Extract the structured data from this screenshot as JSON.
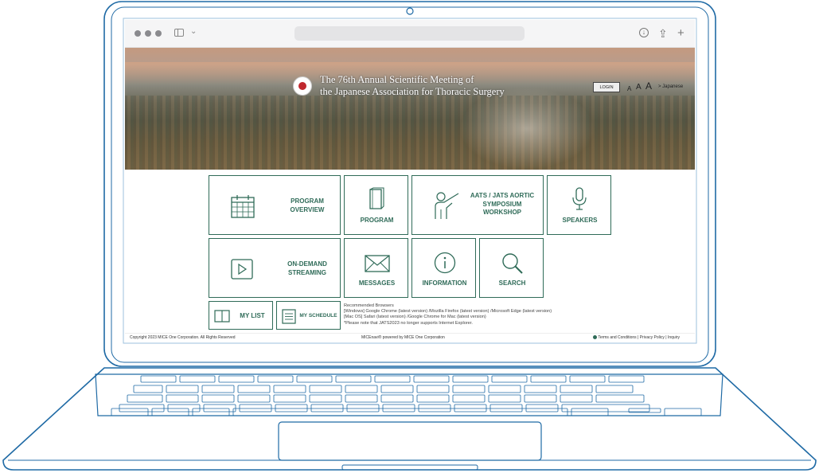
{
  "hero": {
    "title_line1": "The 76th Annual Scientific Meeting of",
    "title_line2": "the Japanese Association for Thoracic Surgery"
  },
  "header": {
    "login_label": "LOGIN",
    "font_small": "A",
    "font_medium": "A",
    "font_large": "A",
    "language_link": "> Japanese"
  },
  "menu": {
    "program_overview": "PROGRAM OVERVIEW",
    "program": "PROGRAM",
    "aats_workshop": "AATS / JATS AORTIC SYMPOSIUM WORKSHOP",
    "speakers": "SPEAKERS",
    "on_demand": "ON-DEMAND STREAMING",
    "messages": "MESSAGES",
    "information": "INFORMATION",
    "search": "SEARCH",
    "my_list": "MY LIST",
    "my_schedule": "MY SCHEDULE"
  },
  "browser_note": {
    "heading": "Recommended Browsers",
    "windows": "[Windows] Google Chrome (latest version) /Mozilla Firefox (latest version) /Microsoft Edge (latest version)",
    "mac": "[Mac OS] Safari (latest version) /Google Chrome for Mac (latest version)",
    "ie_note": "*Please note that JATS2023 no longer supports Internet Explorer."
  },
  "footer": {
    "copyright": "Copyright 2023 MICE One Corporation. All Rights Reserved",
    "powered": "MICEnavi® powered by MICE One Corporation",
    "terms": "Terms and Conditions",
    "privacy": "Privacy Policy",
    "inquiry": "Inquiry"
  },
  "colors": {
    "accent": "#2f6b58",
    "laptop_outline": "#1f6aa5"
  }
}
